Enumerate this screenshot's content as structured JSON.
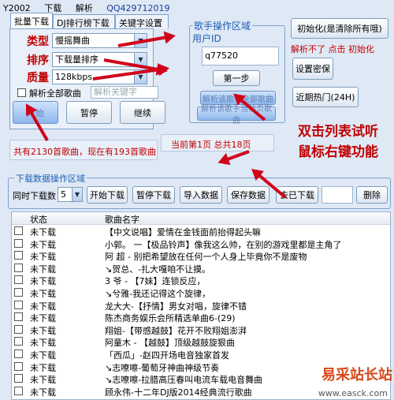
{
  "menu": [
    "Y2002",
    "下载",
    "解析",
    "QQ429712019"
  ],
  "tabs": [
    "批量下载",
    "DJ排行榜下载",
    "关键字设置"
  ],
  "filters": {
    "type_label": "类型",
    "type_value": "慢摇舞曲",
    "sort_label": "排序",
    "sort_value": "下载量排序",
    "quality_label": "质量",
    "quality_value": "128kbps",
    "parse_all": "解析全部歌曲",
    "keyword_placeholder": "解析关键字"
  },
  "actions": {
    "start": "开始",
    "pause": "暂停",
    "continue": "继续"
  },
  "singer": {
    "title": "歌手操作区域",
    "user_id_label": "用户ID",
    "user_id_value": "q77520",
    "next_step": "第一步",
    "btn_parse_all": "解析该歌手全部歌曲",
    "btn_parse_page": "解析该歌手当前页歌曲"
  },
  "right_buttons": {
    "init": "初始化(是清除所有哦)",
    "hint": "解析不了  点击 初始化",
    "cipher": "设置密保",
    "recent": "近期热门(24H)"
  },
  "status": {
    "total": "共有2130首歌曲，现在有193首歌曲",
    "page": "当前第1页  总共18页",
    "tip_line1": "双击列表试听",
    "tip_line2": "鼠标右键功能"
  },
  "download_area": {
    "title": "下载数据操作区域",
    "concurrent_label": "同时下载数",
    "concurrent_value": "5",
    "start": "开始下载",
    "pause": "暂停下载",
    "import": "导入数据",
    "save": "保存数据",
    "goto": "去已下载",
    "delete": "删除"
  },
  "table": {
    "col_status": "状态",
    "col_name": "歌曲名字",
    "rows": [
      {
        "status": "未下载",
        "name": "【中文说唱】爱情在金钱面前抬得起头嘛"
      },
      {
        "status": "未下载",
        "name": "小郭。 一【极品铃声】像我这么帅，在别的游戏里都是主角了"
      },
      {
        "status": "未下载",
        "name": "   阿   超  - 别把希望放在任何一个人身上毕竟你不是废物"
      },
      {
        "status": "未下载",
        "name": "↘贺总、-扎大嘎咱不让摸。"
      },
      {
        "status": "未下载",
        "name": "3  爷  - 【7妹】连锁反应，"
      },
      {
        "status": "未下载",
        "name": "↘兮雅-我还记得这个旋律，"
      },
      {
        "status": "未下载",
        "name": "龙大大-【抒情】男女对唱，旋律不错"
      },
      {
        "status": "未下载",
        "name": "陈杰商务娱乐会所精选单曲6-(29)"
      },
      {
        "status": "未下载",
        "name": "翔姐-【带感越鼓】花开不败翔姐澎湃"
      },
      {
        "status": "未下载",
        "name": "阿童木  - 【越鼓】顶级越鼓旋狠曲"
      },
      {
        "status": "未下载",
        "name": "「西瓜」-赵四开场电音独家首发"
      },
      {
        "status": "未下载",
        "name": "↘志嘹嚓-葡萄牙神曲神级节奏"
      },
      {
        "status": "未下载",
        "name": "↘志嘹嚓-拉腊高压春叫电流车载电音舞曲"
      },
      {
        "status": "未下载",
        "name": "顾永伟-十二年DJ版2014经典流行歌曲"
      }
    ]
  },
  "watermark": {
    "text": "易采站长站",
    "url": "www.easck.com"
  },
  "colors": {
    "accent_red": "#d0021b",
    "group_blue": "#1f5fb3",
    "bg": "#dfe8f5"
  }
}
